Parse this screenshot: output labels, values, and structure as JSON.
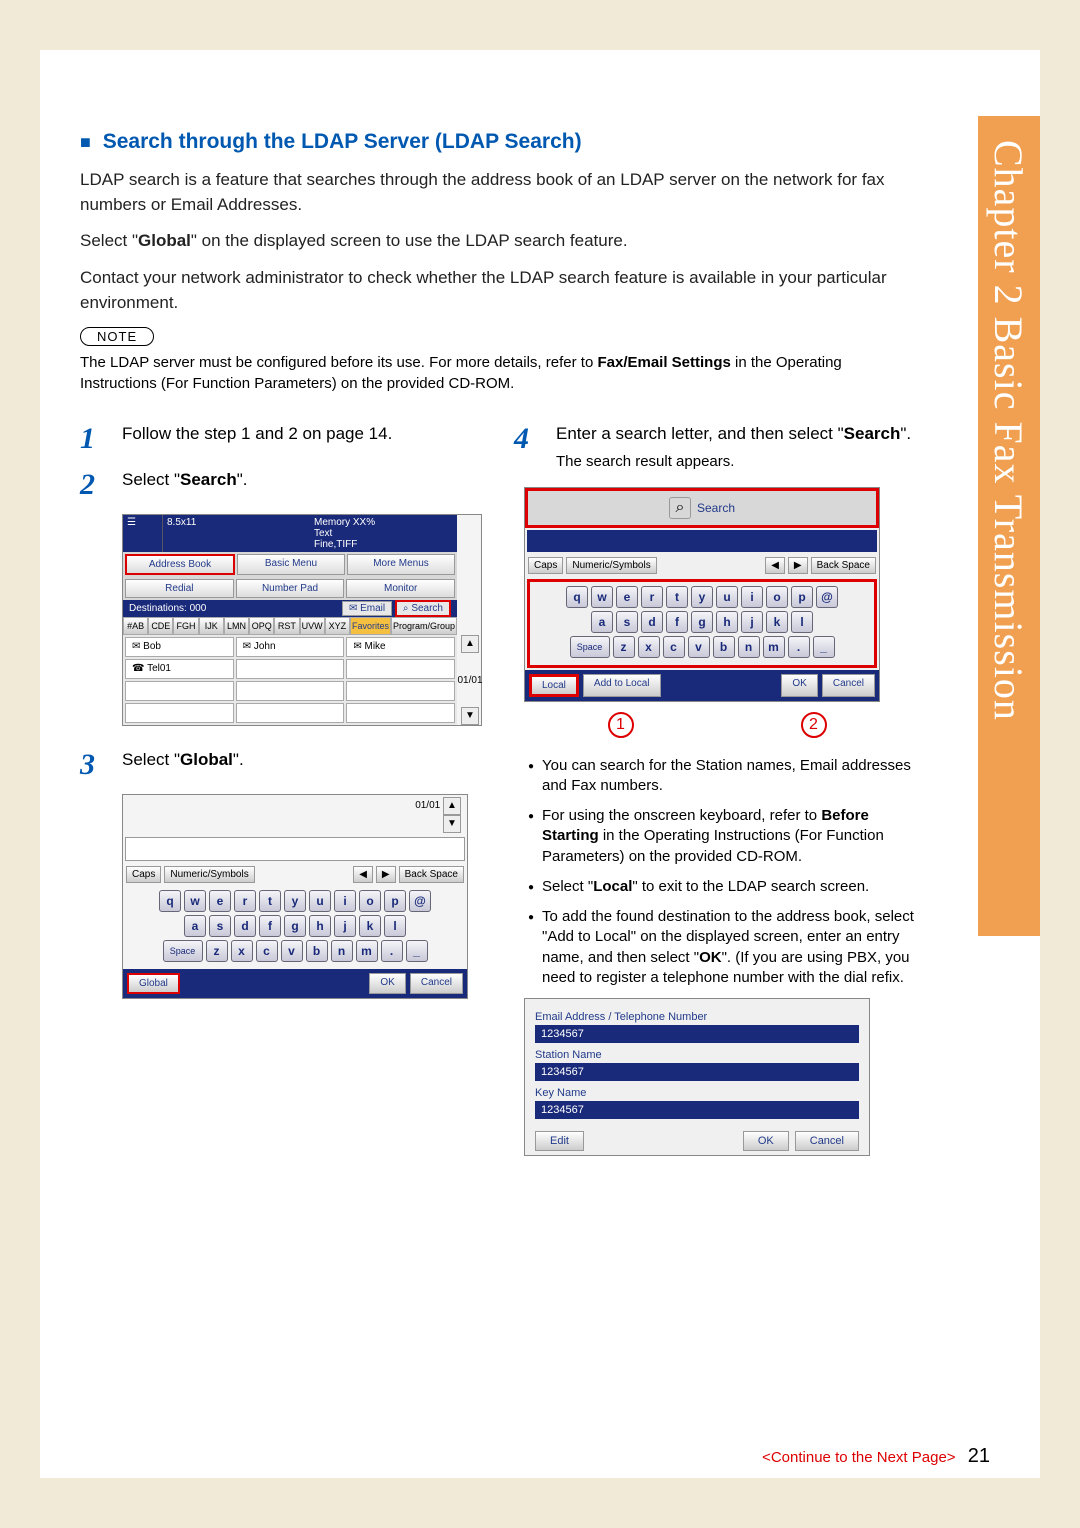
{
  "sideTab": "Chapter 2    Basic Fax Transmission",
  "section": {
    "square": "■",
    "title": "Search through the LDAP Server (LDAP Search)",
    "para1": "LDAP search is a feature that searches through the address book of an LDAP server on the network for fax numbers or Email Addresses.",
    "para2_a": "Select \"",
    "para2_b": "Global",
    "para2_c": "\" on the displayed screen to use the LDAP search feature.",
    "para3": "Contact your network administrator to check whether the LDAP search feature is available in your particular environment."
  },
  "note": {
    "label": "NOTE",
    "text_a": "The LDAP server must be configured before its use. For more details, refer to ",
    "text_b": "Fax/Email Settings",
    "text_c": " in the Operating Instructions (For Function Parameters) on the provided CD-ROM."
  },
  "steps": {
    "s1": {
      "num": "1",
      "text": "Follow the step 1 and 2 on page 14."
    },
    "s2": {
      "num": "2",
      "text_a": "Select \"",
      "bold": "Search",
      "text_b": "\"."
    },
    "s3": {
      "num": "3",
      "text_a": "Select \"",
      "bold": "Global",
      "text_b": "\"."
    },
    "s4": {
      "num": "4",
      "text_a": "Enter a search letter, and then select \"",
      "bold": "Search",
      "text_b": "\".",
      "sub": "The search result appears."
    }
  },
  "fig1": {
    "size": "8.5x11",
    "mem": "Memory XX%",
    "text": "Text",
    "fine": "Fine,TIFF",
    "addrbook": "Address Book",
    "basic": "Basic Menu",
    "more": "More Menus",
    "redial": "Redial",
    "numpad": "Number Pad",
    "monitor": "Monitor",
    "dest": "Destinations: 000",
    "email": "Email",
    "search": "Search",
    "tabs": [
      "#AB",
      "CDE",
      "FGH",
      "IJK",
      "LMN",
      "OPQ",
      "RST",
      "UVW",
      "XYZ",
      "Favorites",
      "Program/Group"
    ],
    "rows": [
      "Bob",
      "John",
      "Mike",
      "Tel01"
    ],
    "counter": "01/01"
  },
  "kb": {
    "caps": "Caps",
    "numsym": "Numeric/Symbols",
    "backspace": "Back Space",
    "space": "Space",
    "row1": [
      "q",
      "w",
      "e",
      "r",
      "t",
      "y",
      "u",
      "i",
      "o",
      "p",
      "@"
    ],
    "row2": [
      "a",
      "s",
      "d",
      "f",
      "g",
      "h",
      "j",
      "k",
      "l"
    ],
    "row3": [
      "z",
      "x",
      "c",
      "v",
      "b",
      "n",
      "m",
      ".",
      "_"
    ],
    "global": "Global",
    "ok": "OK",
    "cancel": "Cancel",
    "counter": "01/01"
  },
  "fig4": {
    "search": "Search",
    "local": "Local",
    "addlocal": "Add to Local",
    "ok": "OK",
    "cancel": "Cancel"
  },
  "circles": {
    "one": "1",
    "two": "2"
  },
  "bullets": {
    "b1": "You can search for the Station names, Email addresses and Fax numbers.",
    "b2_a": "For using the onscreen keyboard, refer to ",
    "b2_b": "Before Starting",
    "b2_c": " in the Operating Instructions (For Function Parameters) on the provided CD-ROM.",
    "b3_a": "Select \"",
    "b3_b": "Local",
    "b3_c": "\" to exit to the LDAP search screen.",
    "b4_a": "To add the found destination to the address book, select \"Add to Local\" on the displayed screen, enter an entry name, and then select \"",
    "b4_b": "OK",
    "b4_c": "\". (If you are using PBX, you need to register a telephone number with the dial refix."
  },
  "fig5": {
    "label1": "Email Address / Telephone Number",
    "val": "1234567",
    "label2": "Station Name",
    "label3": "Key Name",
    "edit": "Edit",
    "ok": "OK",
    "cancel": "Cancel"
  },
  "footer": {
    "cont": "<Continue to the Next Page>",
    "page": "21"
  }
}
